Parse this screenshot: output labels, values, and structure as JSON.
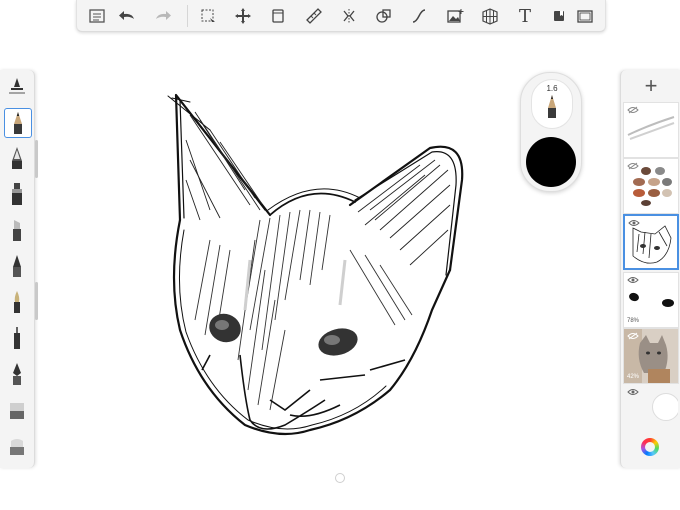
{
  "toolbar": {
    "left_tools": [
      "list-icon",
      "undo-icon",
      "redo-icon"
    ],
    "right_tools": [
      "select-icon",
      "move-icon",
      "fill-bucket-icon",
      "ruler-icon",
      "symmetry-icon",
      "shapes-icon",
      "curve-icon",
      "image-icon",
      "perspective-grid-icon",
      "text-icon",
      "book-icon",
      "fullscreen-icon"
    ],
    "text_tool_label": "T"
  },
  "left_tools": [
    "pencil-icon",
    "pencil-selected-icon",
    "airbrush-icon",
    "marker-icon",
    "chisel-icon",
    "ink-pen-icon",
    "paintbrush-icon",
    "fineliner-icon",
    "calligraphy-icon",
    "eraser-icon",
    "blender-icon"
  ],
  "brush": {
    "size": "1.6",
    "color": "#000000"
  },
  "layers": {
    "add_label": "+",
    "items": [
      {
        "name": "brush-strokes-layer",
        "opacity": ""
      },
      {
        "name": "color-swatch-layer",
        "opacity": ""
      },
      {
        "name": "cat-sketch-layer",
        "opacity": ""
      },
      {
        "name": "eyes-layer",
        "opacity": "78%"
      },
      {
        "name": "reference-photo-layer",
        "opacity": "42%"
      },
      {
        "name": "background-layer",
        "opacity": ""
      }
    ]
  },
  "colors": {
    "accent": "#4a90e2",
    "panel": "#f4f4f4"
  }
}
